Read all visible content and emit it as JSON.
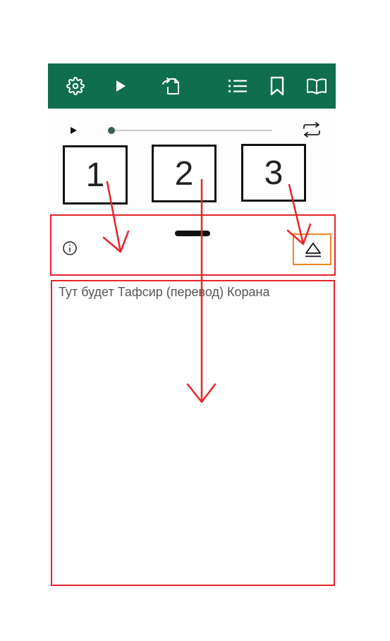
{
  "colors": {
    "toolbar_bg": "#0f6e4e",
    "annotation_red": "#e8232b",
    "annotation_orange": "#f0851f"
  },
  "toolbar": {
    "icons": [
      "gear-icon",
      "play-icon",
      "share-document-icon",
      "list-icon",
      "bookmark-icon",
      "open-book-icon"
    ]
  },
  "player": {
    "progress_fraction": 0.0,
    "icons": [
      "play-icon",
      "repeat-icon"
    ]
  },
  "annotations": {
    "box_1": "1",
    "box_2": "2",
    "box_3": "3"
  },
  "sheet": {
    "icons": [
      "info-icon",
      "eject-icon"
    ]
  },
  "content": {
    "tafsir_text": "Тут будет Тафсир (перевод) Корана"
  }
}
